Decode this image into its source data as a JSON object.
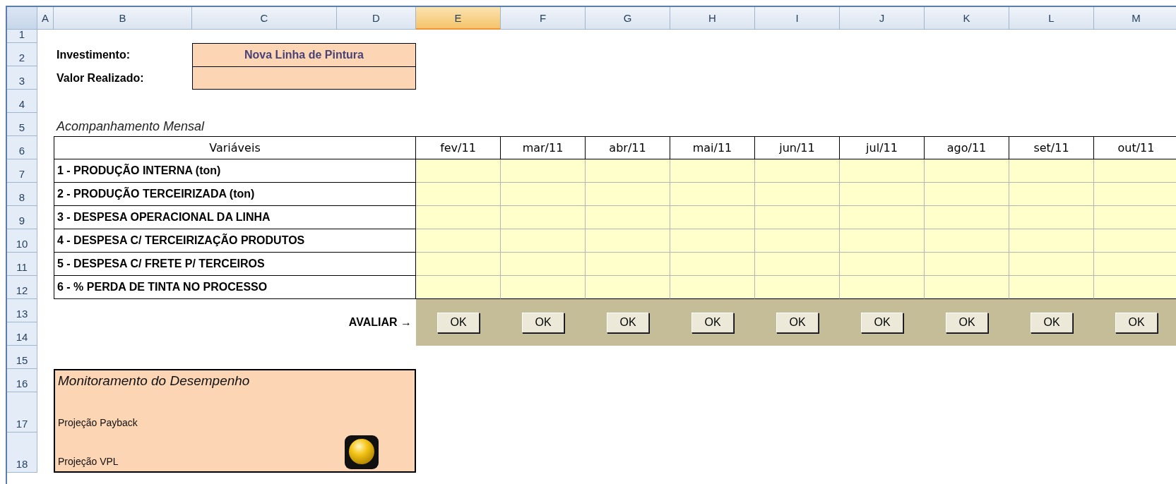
{
  "columns": [
    {
      "label": "A",
      "selected": false
    },
    {
      "label": "B",
      "selected": false
    },
    {
      "label": "C",
      "selected": false
    },
    {
      "label": "D",
      "selected": false
    },
    {
      "label": "E",
      "selected": true
    },
    {
      "label": "F",
      "selected": false
    },
    {
      "label": "G",
      "selected": false
    },
    {
      "label": "H",
      "selected": false
    },
    {
      "label": "I",
      "selected": false
    },
    {
      "label": "J",
      "selected": false
    },
    {
      "label": "K",
      "selected": false
    },
    {
      "label": "L",
      "selected": false
    },
    {
      "label": "M",
      "selected": false
    }
  ],
  "rows": [
    "1",
    "2",
    "3",
    "4",
    "5",
    "6",
    "7",
    "8",
    "9",
    "10",
    "11",
    "12",
    "13",
    "14",
    "15",
    "16",
    "17",
    "18"
  ],
  "investment": {
    "label": "Investimento:",
    "value": "Nova Linha de Pintura"
  },
  "realized": {
    "label": "Valor Realizado:"
  },
  "section_title": "Acompanhamento Mensal",
  "table": {
    "header": "Variáveis",
    "months": [
      "fev/11",
      "mar/11",
      "abr/11",
      "mai/11",
      "jun/11",
      "jul/11",
      "ago/11",
      "set/11",
      "out/11"
    ],
    "rows": [
      "1 - PRODUÇÃO INTERNA (ton)",
      "2 - PRODUÇÃO TERCEIRIZADA (ton)",
      "3 - DESPESA OPERACIONAL DA LINHA",
      "4 - DESPESA C/ TERCEIRIZAÇÃO PRODUTOS",
      "5 - DESPESA C/ FRETE P/ TERCEIROS",
      "6 - % PERDA DE TINTA NO PROCESSO"
    ]
  },
  "evaluate": {
    "label": "AVALIAR →",
    "buttons": [
      "OK",
      "OK",
      "OK",
      "OK",
      "OK",
      "OK",
      "OK",
      "OK",
      "OK"
    ]
  },
  "monitor": {
    "title": "Monitoramento do Desempenho",
    "items": [
      "Projeção Payback",
      "Projeção VPL"
    ]
  }
}
